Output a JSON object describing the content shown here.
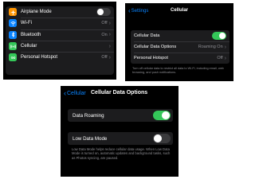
{
  "settings_panel": {
    "rows": [
      {
        "label": "Airplane Mode",
        "icon": "airplane-icon",
        "color": "#ff9500",
        "type": "toggle",
        "state": "off"
      },
      {
        "label": "Wi-Fi",
        "icon": "wifi-icon",
        "color": "#0a84ff",
        "type": "value",
        "value": "Off"
      },
      {
        "label": "Bluetooth",
        "icon": "bluetooth-icon",
        "color": "#0a84ff",
        "type": "value",
        "value": "On"
      },
      {
        "label": "Cellular",
        "icon": "cellular-icon",
        "color": "#34c759",
        "type": "link"
      },
      {
        "label": "Personal Hotspot",
        "icon": "hotspot-icon",
        "color": "#34c759",
        "type": "value",
        "value": "Off"
      }
    ]
  },
  "cellular_panel": {
    "back_label": "Settings",
    "title": "Cellular",
    "rows": [
      {
        "label": "Cellular Data",
        "type": "toggle",
        "state": "on"
      },
      {
        "label": "Cellular Data Options",
        "type": "value",
        "value": "Roaming On"
      },
      {
        "label": "Personal Hotspot",
        "type": "value",
        "value": "Off"
      }
    ],
    "footnote": "Turn off cellular data to restrict all data to Wi-Fi, including email, web browsing, and push notifications."
  },
  "options_panel": {
    "back_label": "Cellular",
    "title": "Cellular Data Options",
    "data_roaming": {
      "label": "Data Roaming",
      "state": "on"
    },
    "low_data_mode": {
      "label": "Low Data Mode",
      "state": "off"
    },
    "footnote": "Low Data Mode helps reduce cellular data usage. When Low Data Mode is turned on, automatic updates and background tasks, such as Photos syncing, are paused."
  },
  "colors": {
    "accent": "#0a84ff",
    "toggle_on": "#34c759",
    "background": "#000000",
    "cell": "#1c1c1e"
  }
}
